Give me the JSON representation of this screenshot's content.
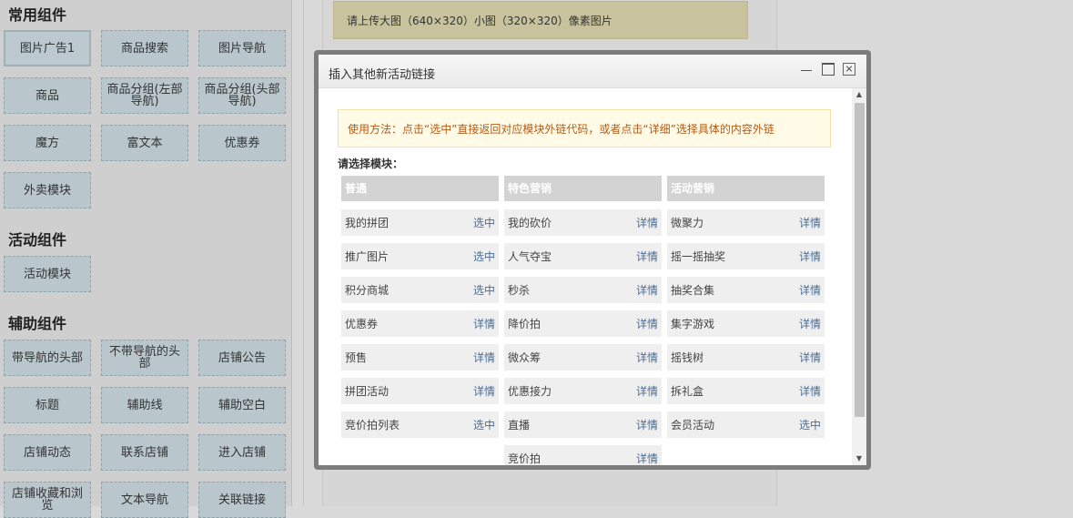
{
  "left": {
    "sections": [
      {
        "title": "常用组件",
        "items": [
          "图片广告1",
          "商品搜索",
          "图片导航",
          "商品",
          "商品分组(左部导航)",
          "商品分组(头部导航)",
          "魔方",
          "富文本",
          "优惠券",
          "外卖模块"
        ]
      },
      {
        "title": "活动组件",
        "items": [
          "活动模块"
        ]
      },
      {
        "title": "辅助组件",
        "items": [
          "带导航的头部",
          "不带导航的头部",
          "店铺公告",
          "标题",
          "辅助线",
          "辅助空白",
          "店铺动态",
          "联系店铺",
          "进入店铺",
          "店铺收藏和浏览",
          "文本导航",
          "关联链接"
        ]
      }
    ]
  },
  "preview": {
    "notice": "请上传大图（640×320）小图（320×320）像素图片"
  },
  "modal": {
    "title": "插入其他新活动链接",
    "tip": "使用方法：点击“选中”直接返回对应模块外链代码，或者点击“详细”选择具体的内容外链",
    "choose_label": "请选择模块：",
    "columns": [
      {
        "header": "普通",
        "rows": [
          {
            "name": "我的拼团",
            "action": "选中"
          },
          {
            "name": "推广图片",
            "action": "选中"
          },
          {
            "name": "积分商城",
            "action": "选中"
          },
          {
            "name": "优惠券",
            "action": "详情"
          },
          {
            "name": "预售",
            "action": "详情"
          },
          {
            "name": "拼团活动",
            "action": "详情"
          },
          {
            "name": "竞价拍列表",
            "action": "选中"
          }
        ]
      },
      {
        "header": "特色营销",
        "rows": [
          {
            "name": "我的砍价",
            "action": "详情"
          },
          {
            "name": "人气夺宝",
            "action": "详情"
          },
          {
            "name": "秒杀",
            "action": "详情"
          },
          {
            "name": "降价拍",
            "action": "详情"
          },
          {
            "name": "微众筹",
            "action": "详情"
          },
          {
            "name": "优惠接力",
            "action": "详情"
          },
          {
            "name": "直播",
            "action": "详情"
          },
          {
            "name": "竞价拍",
            "action": "详情"
          }
        ]
      },
      {
        "header": "活动营销",
        "rows": [
          {
            "name": "微聚力",
            "action": "详情"
          },
          {
            "name": "摇一摇抽奖",
            "action": "详情"
          },
          {
            "name": "抽奖合集",
            "action": "详情"
          },
          {
            "name": "集字游戏",
            "action": "详情"
          },
          {
            "name": "摇钱树",
            "action": "详情"
          },
          {
            "name": "拆礼盒",
            "action": "详情"
          },
          {
            "name": "会员活动",
            "action": "选中"
          }
        ]
      }
    ]
  }
}
